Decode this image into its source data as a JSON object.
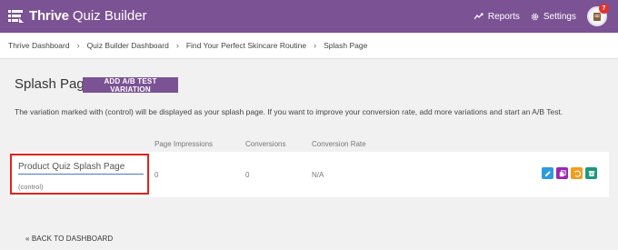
{
  "app": {
    "brand": "Thrive",
    "product": "Quiz Builder"
  },
  "topnav": {
    "reports_label": "Reports",
    "settings_label": "Settings",
    "notification_count": "7"
  },
  "breadcrumbs": [
    "Thrive Dashboard",
    "Quiz Builder Dashboard",
    "Find Your Perfect Skincare Routine",
    "Splash Page"
  ],
  "breadcrumb_separator": "›",
  "page": {
    "title": "Splash Page",
    "ab_button_label": "ADD A/B TEST VARIATION",
    "description": "The variation marked with (control) will be displayed as your splash page. If you want to improve your conversion rate, add more variations and start an A/B Test."
  },
  "table": {
    "columns": [
      "Page Impressions",
      "Conversions",
      "Conversion Rate"
    ],
    "rows": [
      {
        "name": "Product Quiz Splash Page",
        "tag": "(control)",
        "impressions": "0",
        "conversions": "0",
        "conversion_rate": "N/A"
      }
    ]
  },
  "row_actions": [
    {
      "icon": "edit-icon",
      "color": "#2c9be0"
    },
    {
      "icon": "copy-icon",
      "color": "#9b27b0"
    },
    {
      "icon": "reset-icon",
      "color": "#f59c1a"
    },
    {
      "icon": "archive-icon",
      "color": "#1a9a7c"
    }
  ],
  "footer": {
    "back_label": "« BACK TO DASHBOARD"
  },
  "colors": {
    "brand": "#7b5294",
    "highlight": "#e2221d"
  }
}
